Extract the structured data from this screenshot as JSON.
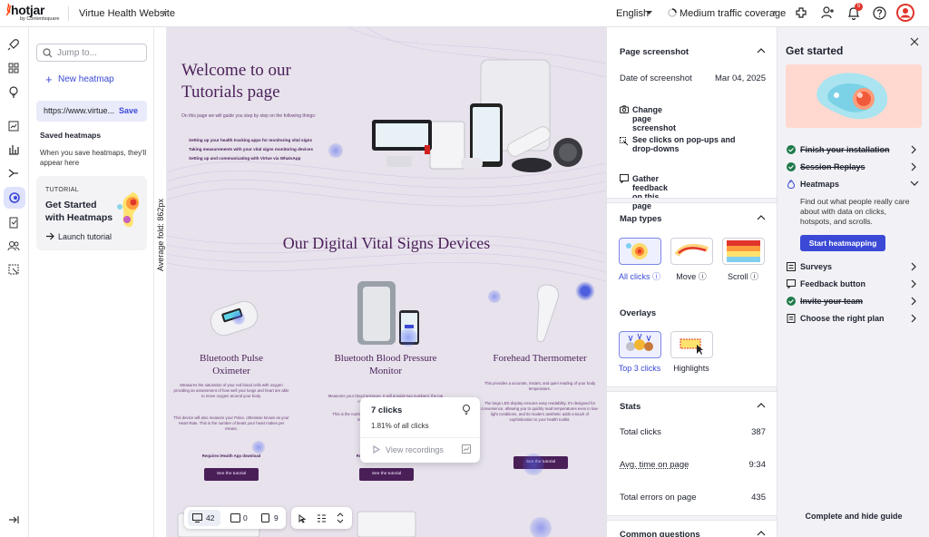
{
  "topbar": {
    "logo": "hotjar",
    "logo_sub": "by Contentsquare",
    "site": "Virtue Health Website",
    "language": "English",
    "traffic": "Medium traffic coverage",
    "notification_count": "5"
  },
  "sidebar": {
    "search_placeholder": "Jump to...",
    "new_heatmap": "New heatmap",
    "url": "https://www.virtue...",
    "save": "Save",
    "saved_title": "Saved heatmaps",
    "saved_desc": "When you save heatmaps, they'll appear here",
    "tutorial_tag": "TUTORIAL",
    "tutorial_title": "Get Started with Heatmaps",
    "tutorial_launch": "Launch tutorial"
  },
  "fold_label": "Average fold: 862px",
  "preview": {
    "hero_title_1": "Welcome to our",
    "hero_title_2": "Tutorials page",
    "hero_intro": "On this page we will guide you step by step on the following things:",
    "hero_steps": [
      "Setting up your health tracking apps for monitoring vital signs",
      "Taking measurements with your vital signs monitoring devices",
      "Setting up and communicating with Virtue via WhatsApp"
    ],
    "section_title": "Our Digital Vital Signs Devices",
    "products": [
      {
        "title_1": "Bluetooth Pulse",
        "title_2": "Oximeter",
        "desc": "Measures the saturation of your red blood cells with oxygen providing an assessment of how well your lungs and heart are able to move oxygen around your body.",
        "desc2": "This device will also measure your Pulse, otherwise known as your Heart Rate. This is the number of beats your heart makes per minute.",
        "note": "Requires iHealth App download",
        "button": "See the tutorial"
      },
      {
        "title_1": "Bluetooth Blood Pressure",
        "title_2": "Monitor",
        "desc": "Measures your blood pressure. It will provide two numbers: the top number and the bottom number.",
        "desc2": "This is the number of beats per minute, systolic will be the top number and diastolic the bottom.",
        "note": "Requires iHealth App download",
        "button": "See the tutorial"
      },
      {
        "title_1": "Forehead Thermometer",
        "title_2": "",
        "desc": "This provides a accurate, instant, and quiet reading of your body temperature.",
        "desc2": "The large LED display ensures easy readability. It's designed for convenience, allowing you to quickly read temperatures even in low-light conditions, and its modern aesthetic adds a touch of sophistication to your health toolkit.",
        "note": "",
        "button": "See the tutorial"
      }
    ],
    "tooltip": {
      "clicks": "7 clicks",
      "percent": "1.81% of all clicks",
      "recordings": "View recordings"
    },
    "bottombar": {
      "desktop": "42",
      "tablet": "0",
      "mobile": "9"
    }
  },
  "settings": {
    "page_screenshot": "Page screenshot",
    "date_label": "Date of screenshot",
    "date_value": "Mar 04, 2025",
    "change_screenshot": "Change page screenshot",
    "popups": "See clicks on pop-ups and drop-downs",
    "feedback": "Gather feedback on this page",
    "map_types": "Map types",
    "maps": [
      "All clicks",
      "Move",
      "Scroll"
    ],
    "overlays": "Overlays",
    "overlay_items": [
      "Top 3 clicks",
      "Highlights"
    ],
    "stats": "Stats",
    "total_clicks_label": "Total clicks",
    "total_clicks": "387",
    "avg_time_label": "Avg. time on page",
    "avg_time": "9:34",
    "errors_label": "Total errors on page",
    "errors": "435",
    "common_questions": "Common questions"
  },
  "guide": {
    "title": "Get started",
    "items": [
      "Finish your installation",
      "Session Replays",
      "Heatmaps",
      "Surveys",
      "Feedback button",
      "Invite your team",
      "Choose the right plan"
    ],
    "heatmaps_desc": "Find out what people really care about with data on clicks, hotspots, and scrolls.",
    "cta": "Start heatmapping",
    "footer": "Complete and hide guide"
  },
  "colors": {
    "accent": "#3b49d6",
    "brand_purple": "#4a1f58",
    "done_green": "#1f7a4a"
  }
}
